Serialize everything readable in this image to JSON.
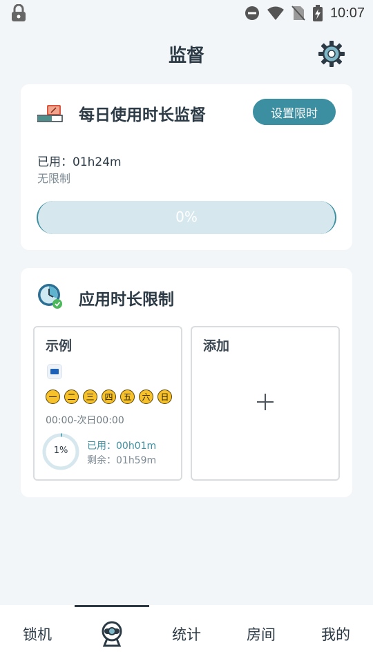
{
  "status_bar": {
    "time": "10:07"
  },
  "header": {
    "title": "监督"
  },
  "daily_card": {
    "title": "每日使用时长监督",
    "set_limit_label": "设置限时",
    "used_text": "已用：01h24m",
    "limit_text": "无限制",
    "progress_value": 0,
    "progress_label": "0%"
  },
  "app_limit_card": {
    "title": "应用时长限制",
    "example": {
      "title": "示例",
      "days": [
        "一",
        "二",
        "三",
        "四",
        "五",
        "六",
        "日"
      ],
      "time_range": "00:00-次日00:00",
      "percent_value": 1,
      "percent_label": "1%",
      "used_text": "已用：00h01m",
      "remaining_text": "剩余：01h59m"
    },
    "add": {
      "title": "添加"
    }
  },
  "bottom_nav": {
    "items": [
      {
        "label": "锁机"
      },
      {
        "label": ""
      },
      {
        "label": "统计"
      },
      {
        "label": "房间"
      },
      {
        "label": "我的"
      }
    ]
  },
  "colors": {
    "accent": "#3b8fa0",
    "progress_track": "#d6e8ee",
    "day_badge": "#f6c12a"
  }
}
